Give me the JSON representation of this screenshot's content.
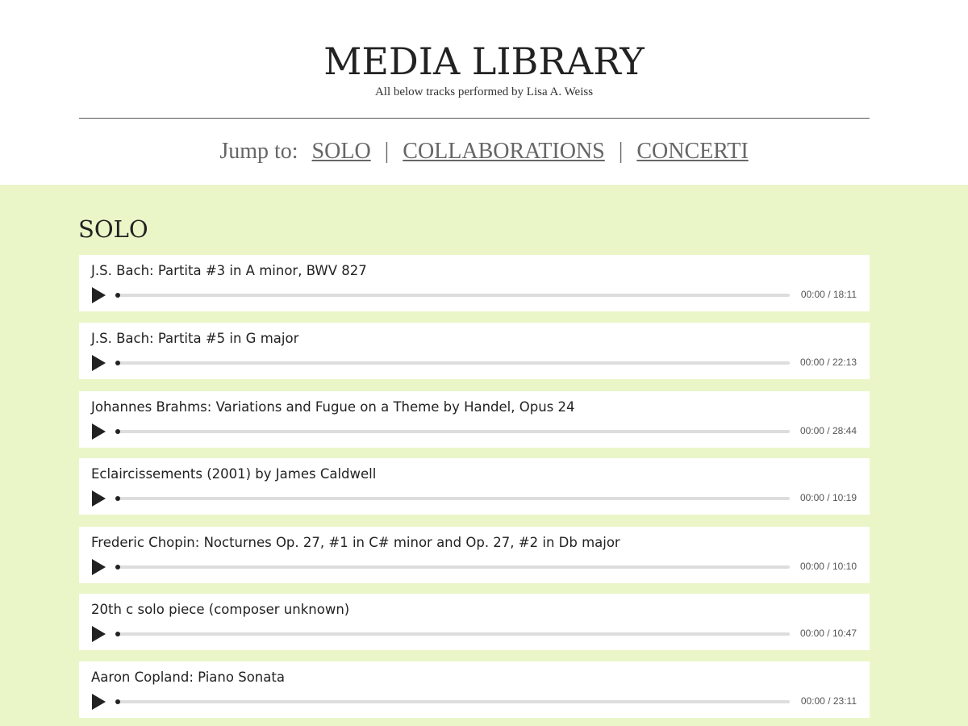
{
  "header": {
    "title": "MEDIA LIBRARY",
    "subtitle": "All below tracks performed by Lisa A. Weiss"
  },
  "jump_nav": {
    "prefix": "Jump to:",
    "separator": "|",
    "links": [
      "SOLO",
      "COLLABORATIONS",
      "CONCERTI"
    ]
  },
  "section": {
    "heading": "SOLO",
    "background_color": "#eaf6c8"
  },
  "tracks": [
    {
      "title": "J.S. Bach: Partita #3 in A minor, BWV 827",
      "time": "00:00 / 18:11"
    },
    {
      "title": "J.S. Bach: Partita #5 in G major",
      "time": "00:00 / 22:13"
    },
    {
      "title": "Johannes Brahms: Variations and Fugue on a Theme by Handel, Opus 24",
      "time": "00:00 / 28:44"
    },
    {
      "title": "Eclaircissements (2001) by James Caldwell",
      "time": "00:00 / 10:19"
    },
    {
      "title": "Frederic Chopin: Nocturnes Op. 27, #1 in C# minor and Op. 27, #2 in Db major",
      "time": "00:00 / 10:10"
    },
    {
      "title": "20th c solo piece (composer unknown)",
      "time": "00:00 / 10:47"
    },
    {
      "title": "Aaron Copland: Piano Sonata",
      "time": "00:00 / 23:11"
    }
  ],
  "icons": {
    "play": "play-icon"
  }
}
